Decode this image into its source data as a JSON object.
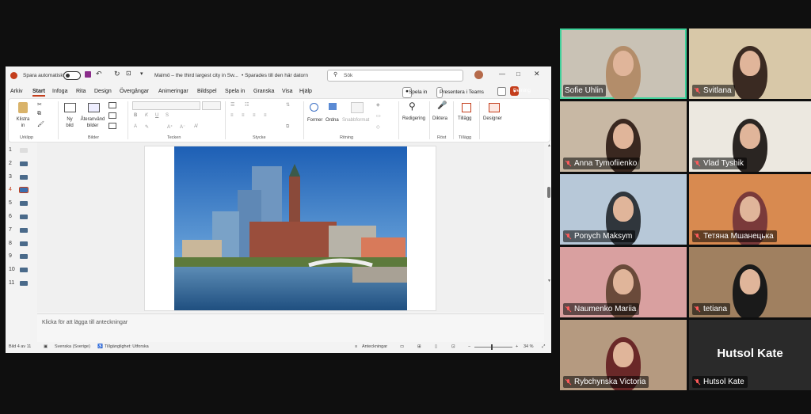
{
  "app": {
    "autosave_label": "Spara automatiskt",
    "doc_title": "Malmö – the third largest city in Sw...",
    "saved_status": "• Sparades till den här datorn",
    "search_placeholder": "Sök",
    "record_label": "Spela in",
    "present_teams_label": "Presentera i Teams",
    "share_label": "Delning"
  },
  "tabs": [
    "Arkiv",
    "Start",
    "Infoga",
    "Rita",
    "Design",
    "Övergångar",
    "Animeringar",
    "Bildspel",
    "Spela in",
    "Granska",
    "Visa",
    "Hjälp"
  ],
  "ribbon": {
    "paste": "Klistra in",
    "clipboard_group": "Urklipp",
    "new_slide": "Ny bild",
    "reuse_slides": "Återanvänd bilder",
    "slides_group": "Bilder",
    "font_group": "Tecken",
    "paragraph_group": "Stycke",
    "shapes": "Former",
    "arrange": "Ordna",
    "quick_styles": "Snabbformat",
    "drawing_group": "Ritning",
    "editing": "Redigering",
    "dictate": "Diktera",
    "voice_group": "Röst",
    "addins": "Tillägg",
    "addins_group": "Tillägg",
    "designer": "Designer"
  },
  "thumbnails": [
    "1",
    "2",
    "3",
    "4",
    "5",
    "6",
    "7",
    "8",
    "9",
    "10",
    "11"
  ],
  "notes_placeholder": "Klicka för att lägga till anteckningar",
  "status": {
    "slide_of": "Bild 4 av 11",
    "language": "Svenska (Sverige)",
    "accessibility": "Tillgänglighet: Utforska",
    "notes": "Anteckningar",
    "zoom": "34 %"
  },
  "participants": [
    "Sofie Uhlin",
    "Svitlana",
    "Anna Tymofiienko",
    "Vlad Tyshik",
    "Ponych Maksym",
    "Тетяна Мшанецька",
    "Naumenko Mariia",
    "tetiana",
    "Rybchynska Victoria",
    "Hutsol Kate"
  ],
  "placeholder_name": "Hutsol Kate",
  "colors": {
    "accent": "#c43e1c",
    "active_speaker": "#3fd19a"
  }
}
